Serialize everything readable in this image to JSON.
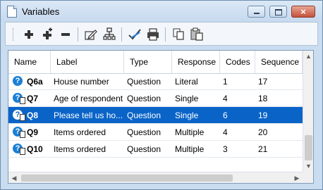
{
  "window": {
    "title": "Variables",
    "min_icon": "minimize-icon",
    "max_icon": "maximize-icon",
    "close_label": "×"
  },
  "toolbar": {
    "buttons": [
      {
        "name": "add-variable-button",
        "icon": "plus-icon"
      },
      {
        "name": "add-special-button",
        "icon": "plus-star-icon"
      },
      {
        "name": "remove-variable-button",
        "icon": "minus-icon"
      },
      {
        "name": "edit-button",
        "icon": "edit-icon"
      },
      {
        "name": "hierarchy-button",
        "icon": "hierarchy-icon"
      },
      {
        "name": "check-button",
        "icon": "check-brush-icon"
      },
      {
        "name": "print-button",
        "icon": "printer-icon"
      },
      {
        "name": "copy-button",
        "icon": "copy-icon"
      },
      {
        "name": "paste-button",
        "icon": "paste-icon"
      }
    ]
  },
  "table": {
    "columns": [
      "Name",
      "Label",
      "Type",
      "Response",
      "Codes",
      "Sequence"
    ],
    "rows": [
      {
        "name": "Q6a",
        "label": "House number",
        "type": "Question",
        "response": "Literal",
        "codes": "1",
        "sequence": "17",
        "selected": false,
        "multi": false
      },
      {
        "name": "Q7",
        "label": "Age of respondent",
        "type": "Question",
        "response": "Single",
        "codes": "4",
        "sequence": "18",
        "selected": false,
        "multi": true
      },
      {
        "name": "Q8",
        "label": "Please tell us ho...",
        "type": "Question",
        "response": "Single",
        "codes": "6",
        "sequence": "19",
        "selected": true,
        "multi": true
      },
      {
        "name": "Q9",
        "label": "Items ordered",
        "type": "Question",
        "response": "Multiple",
        "codes": "4",
        "sequence": "20",
        "selected": false,
        "multi": true
      },
      {
        "name": "Q10",
        "label": "Items ordered",
        "type": "Question",
        "response": "Multiple",
        "codes": "3",
        "sequence": "21",
        "selected": false,
        "multi": true
      }
    ]
  }
}
